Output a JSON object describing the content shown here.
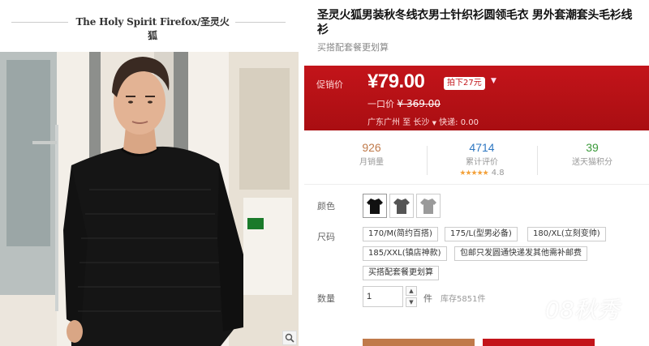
{
  "brand": {
    "title": "The Holy Spirit Firefox/圣灵火狐"
  },
  "product": {
    "title": "圣灵火狐男装秋冬线衣男士针织衫圆领毛衣 男外套潮套头毛衫线衫",
    "subtitle": "买搭配套餐更划算"
  },
  "price_box": {
    "label": "促销价",
    "price": "¥79.00",
    "discount_badge": "拍下27元",
    "original_label": "一口价",
    "original_price": "¥ 369.00",
    "ship_from": "广东广州",
    "ship_to_word": "至",
    "ship_to": "长沙",
    "shipping_label": "快递: 0.00"
  },
  "stats": {
    "monthly_sales": {
      "value": "926",
      "label": "月销量"
    },
    "reviews": {
      "value": "4714",
      "label": "累计评价",
      "stars": "★★★★★",
      "rating": "4.8"
    },
    "points": {
      "value": "39",
      "label": "送天猫积分"
    }
  },
  "colors": {
    "label": "颜色",
    "options": [
      "black",
      "dark-gray",
      "light-gray"
    ]
  },
  "sizes": {
    "label": "尺码",
    "options": [
      "170/M(简约百搭)",
      "175/L(型男必备)",
      "180/XL(立刻变帅)",
      "185/XXL(镇店神款)",
      "包邮只发圆通快递发其他需补邮费",
      "买搭配套餐更划算"
    ]
  },
  "quantity": {
    "label": "数量",
    "value": "1",
    "unit": "件",
    "stock": "库存5851件"
  },
  "watermark": {
    "text": "08秋秀"
  },
  "theme": {
    "accent": "#c3141a",
    "brand_brown": "#c07a4a"
  }
}
